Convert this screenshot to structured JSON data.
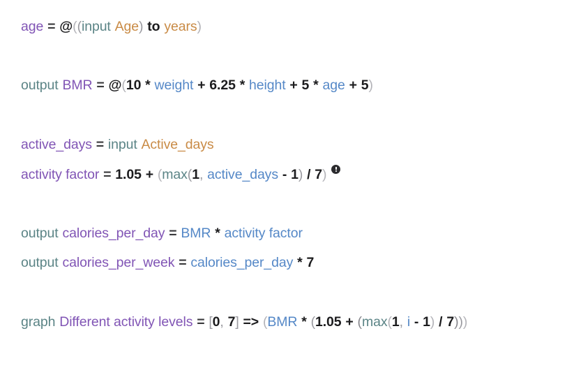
{
  "document": {
    "title": "Calculation sheet",
    "background": "#ffffff",
    "palette": {
      "defined_name": "#8155b5",
      "reference": "#5588c7",
      "keyword": "#5b8486",
      "unit": "#c98b46",
      "number": "#1c1c1e",
      "operator": "#1c1c1e",
      "paren": "#b3b3b8",
      "badge": "#2b2b2e"
    }
  },
  "lines": [
    {
      "id": "line-age",
      "text": "age = @((input Age) to years)",
      "tokens": {
        "name": "age",
        "equals": "=",
        "at": "@",
        "open1": "(",
        "open2": "(",
        "input_kw": "input",
        "input_label": "Age",
        "close1": ")",
        "to_kw": "to",
        "unit": "years",
        "close2": ")"
      }
    },
    {
      "id": "line-bmr",
      "text": "output BMR = @(10 * weight + 6.25 * height + 5 * age + 5)",
      "tokens": {
        "output_kw": "output",
        "name": "BMR",
        "equals": "=",
        "at": "@",
        "open": "(",
        "n10": "10",
        "mul1": "*",
        "weight": "weight",
        "plus1": "+",
        "n625": "6.25",
        "mul2": "*",
        "height": "height",
        "plus2": "+",
        "n5a": "5",
        "mul3": "*",
        "age": "age",
        "plus3": "+",
        "n5b": "5",
        "close": ")"
      }
    },
    {
      "id": "line-active-days",
      "text": "active_days = input Active_days",
      "tokens": {
        "name": "active_days",
        "equals": "=",
        "input_kw": "input",
        "input_label": "Active_days"
      }
    },
    {
      "id": "line-activity-factor",
      "text": "activity factor = 1.05 + (max(1, active_days - 1) / 7)",
      "has_badge": true,
      "badge_icon": "warning-info-icon",
      "tokens": {
        "name": "activity factor",
        "equals": "=",
        "n105": "1.05",
        "plus": "+",
        "open1": "(",
        "fn": "max",
        "open2": "(",
        "n1a": "1",
        "comma": ",",
        "ref": "active_days",
        "minus": "-",
        "n1b": "1",
        "close2": ")",
        "div": "/",
        "n7": "7",
        "close1": ")"
      }
    },
    {
      "id": "line-calories-per-day",
      "text": "output calories_per_day = BMR * activity factor",
      "tokens": {
        "output_kw": "output",
        "name": "calories_per_day",
        "equals": "=",
        "ref1": "BMR",
        "mul": "*",
        "ref2": "activity factor"
      }
    },
    {
      "id": "line-calories-per-week",
      "text": "output calories_per_week = calories_per_day * 7",
      "tokens": {
        "output_kw": "output",
        "name": "calories_per_week",
        "equals": "=",
        "ref1": "calories_per_day",
        "mul": "*",
        "n7": "7"
      }
    },
    {
      "id": "line-graph",
      "text": "graph Different activity levels = [0, 7] => (BMR * (1.05 + (max(1, i - 1) / 7)))",
      "tokens": {
        "graph_kw": "graph",
        "name": "Different activity levels",
        "equals": "=",
        "bracket_open": "[",
        "range_start": "0",
        "comma1": ",",
        "range_end": "7",
        "bracket_close": "]",
        "arrow": "=>",
        "open1": "(",
        "ref_bmr": "BMR",
        "mul": "*",
        "open2": "(",
        "n105": "1.05",
        "plus": "+",
        "open3": "(",
        "fn": "max",
        "open4": "(",
        "n1a": "1",
        "comma2": ",",
        "var_i": "i",
        "minus": "-",
        "n1b": "1",
        "close4": ")",
        "div": "/",
        "n7": "7",
        "close3": ")",
        "close2": ")",
        "close1": ")"
      }
    }
  ]
}
